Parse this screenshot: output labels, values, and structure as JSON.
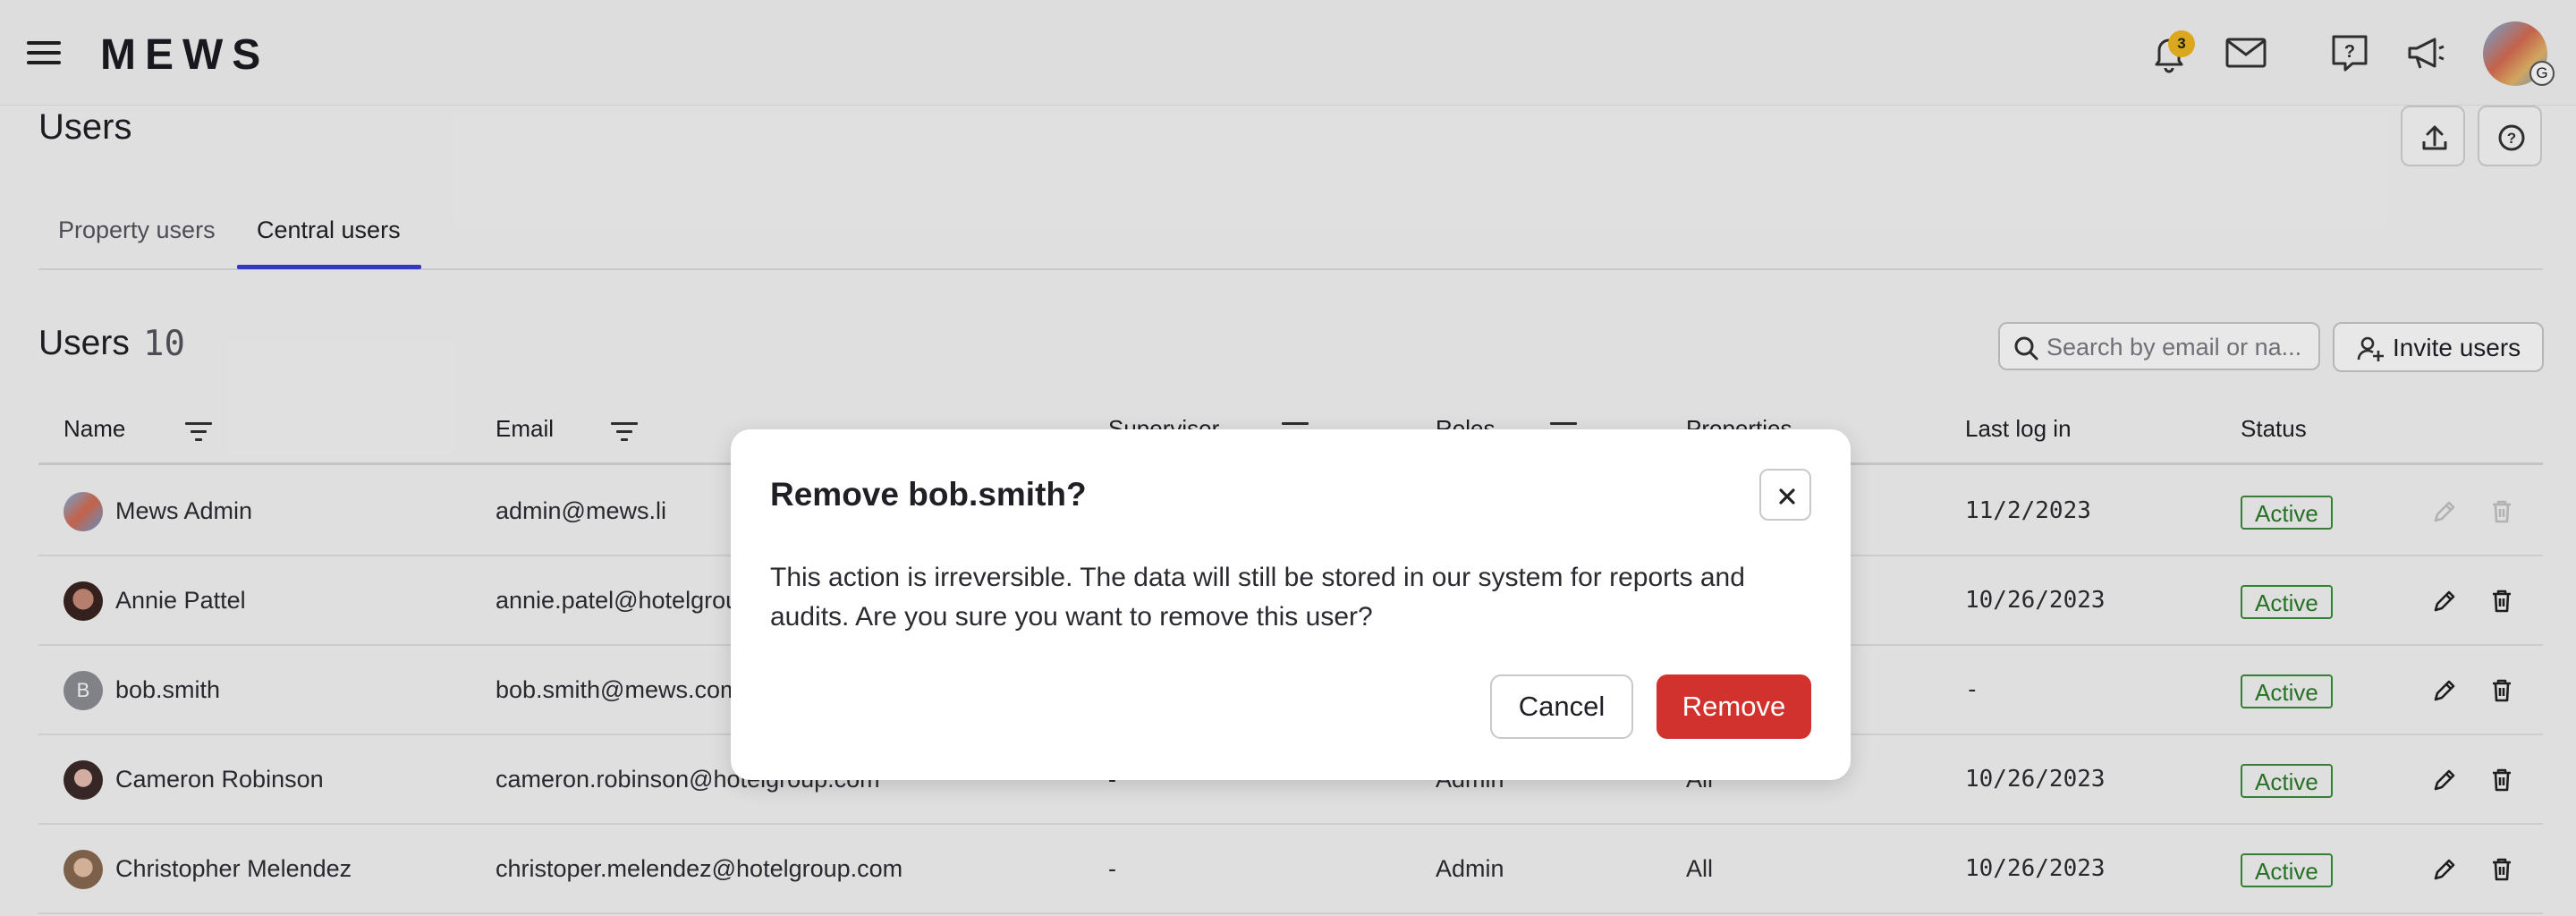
{
  "app": {
    "logo": "MEWS",
    "notifications_count": "3",
    "avatar_badge": "G"
  },
  "page": {
    "title": "Users",
    "tabs": [
      {
        "label": "Property users"
      },
      {
        "label": "Central users"
      }
    ],
    "active_tab": "Central users"
  },
  "users_section": {
    "heading": "Users",
    "count": "10",
    "search_placeholder": "Search by email or na...",
    "invite_label": "Invite users"
  },
  "table": {
    "columns": [
      "Name",
      "Email",
      "Supervisor",
      "Roles",
      "Properties",
      "Last log in",
      "Status"
    ],
    "rows": [
      {
        "name": "Mews Admin",
        "email": "admin@mews.li",
        "supervisor": "",
        "roles": "",
        "properties": "",
        "last_login": "11/2/2023",
        "status": "Active",
        "avatar": "photo",
        "actions_enabled": false
      },
      {
        "name": "Annie Pattel",
        "email": "annie.patel@hotelgrou",
        "supervisor": "",
        "roles": "",
        "properties": "",
        "last_login": "10/26/2023",
        "status": "Active",
        "avatar": "photo",
        "actions_enabled": true
      },
      {
        "name": "bob.smith",
        "email": "bob.smith@mews.com",
        "supervisor": "",
        "roles": "",
        "properties": "",
        "last_login": "-",
        "status": "Active",
        "avatar": "B",
        "actions_enabled": true
      },
      {
        "name": "Cameron Robinson",
        "email": "cameron.robinson@hotelgroup.com",
        "supervisor": "-",
        "roles": "Admin",
        "properties": "All",
        "last_login": "10/26/2023",
        "status": "Active",
        "avatar": "photo",
        "actions_enabled": true
      },
      {
        "name": "Christopher Melendez",
        "email": "christoper.melendez@hotelgroup.com",
        "supervisor": "-",
        "roles": "Admin",
        "properties": "All",
        "last_login": "10/26/2023",
        "status": "Active",
        "avatar": "photo",
        "actions_enabled": true
      }
    ]
  },
  "modal": {
    "title": "Remove bob.smith?",
    "body": "This action is irreversible. The data will still be stored in our system for reports and audits. Are you sure you want to remove this user?",
    "cancel_label": "Cancel",
    "remove_label": "Remove"
  },
  "colors": {
    "accent": "#3a3fd6",
    "danger": "#d2322d",
    "status_active": "#2a7d2a",
    "badge": "#f0b820"
  },
  "icons": [
    "menu-icon",
    "bell-icon",
    "mail-icon",
    "help-chat-icon",
    "megaphone-icon",
    "upload-icon",
    "help-icon",
    "search-icon",
    "add-user-icon",
    "filter-icon",
    "edit-icon",
    "trash-icon",
    "close-icon"
  ]
}
